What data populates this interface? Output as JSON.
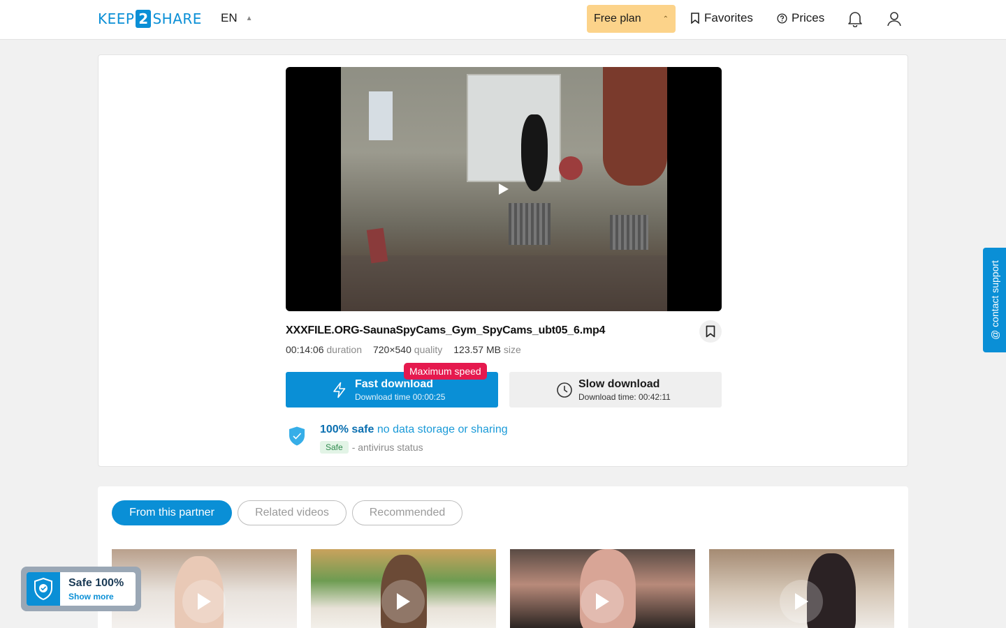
{
  "header": {
    "logo_left": "KEEP",
    "logo_mid": "2",
    "logo_right": "SHARE",
    "language": "EN",
    "plan_label": "Free plan",
    "favorites_label": "Favorites",
    "prices_label": "Prices",
    "icons": {
      "bell": "bell-icon",
      "user": "user-icon",
      "bookmark": "bookmark-icon",
      "help": "question-circle-icon"
    }
  },
  "file": {
    "name": "XXXFILE.ORG-SaunaSpyCams_Gym_SpyCams_ubt05_6.mp4",
    "duration": "00:14:06",
    "duration_label": "duration",
    "quality": "720×540",
    "quality_label": "quality",
    "size": "123.57 MB",
    "size_label": "size"
  },
  "download": {
    "badge": "Maximum speed",
    "fast_title": "Fast download",
    "fast_sub": "Download time 00:00:25",
    "slow_title": "Slow download",
    "slow_sub": "Download time: 00:42:11"
  },
  "safety": {
    "bold": "100% safe",
    "rest": "no data storage or sharing",
    "status_tag": "Safe",
    "status_text": "- antivirus status"
  },
  "support": {
    "label": "@ contact support"
  },
  "tabs": [
    {
      "label": "From this partner",
      "active": true
    },
    {
      "label": "Related videos",
      "active": false
    },
    {
      "label": "Recommended",
      "active": false
    }
  ],
  "safe_popup": {
    "title": "Safe 100%",
    "link": "Show more"
  },
  "colors": {
    "accent": "#0a8fd6",
    "plan": "#fcd38a",
    "badge": "#e5194e",
    "safe_tag_bg": "#e2f4e6"
  }
}
